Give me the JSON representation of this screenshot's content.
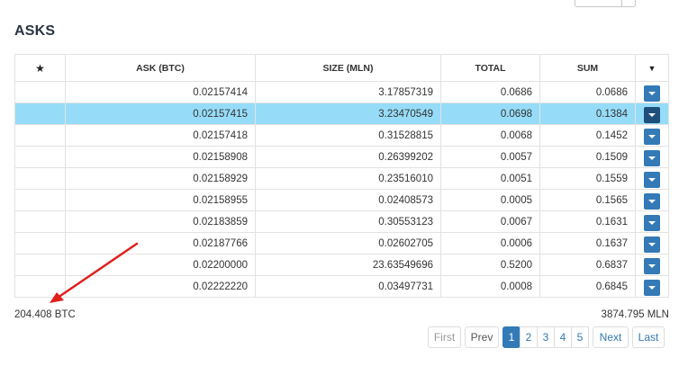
{
  "section_title": "ASKS",
  "table": {
    "headers": [
      "ASK (BTC)",
      "SIZE (MLN)",
      "TOTAL",
      "SUM"
    ],
    "rows": [
      {
        "ask": "0.02157414",
        "size": "3.17857319",
        "total": "0.0686",
        "sum": "0.0686"
      },
      {
        "ask": "0.02157415",
        "size": "3.23470549",
        "total": "0.0698",
        "sum": "0.1384"
      },
      {
        "ask": "0.02157418",
        "size": "0.31528815",
        "total": "0.0068",
        "sum": "0.1452"
      },
      {
        "ask": "0.02158908",
        "size": "0.26399202",
        "total": "0.0057",
        "sum": "0.1509"
      },
      {
        "ask": "0.02158929",
        "size": "0.23516010",
        "total": "0.0051",
        "sum": "0.1559"
      },
      {
        "ask": "0.02158955",
        "size": "0.02408573",
        "total": "0.0005",
        "sum": "0.1565"
      },
      {
        "ask": "0.02183859",
        "size": "0.30553123",
        "total": "0.0067",
        "sum": "0.1631"
      },
      {
        "ask": "0.02187766",
        "size": "0.02602705",
        "total": "0.0006",
        "sum": "0.1637"
      },
      {
        "ask": "0.02200000",
        "size": "23.63549696",
        "total": "0.5200",
        "sum": "0.6837"
      },
      {
        "ask": "0.02222220",
        "size": "0.03497731",
        "total": "0.0008",
        "sum": "0.6845"
      }
    ],
    "selected_row_index": 1
  },
  "footer": {
    "total_btc": "204.408 BTC",
    "total_mln": "3874.795 MLN"
  },
  "pagination": {
    "first": "First",
    "prev": "Prev",
    "pages": [
      "1",
      "2",
      "3",
      "4",
      "5"
    ],
    "active_page": "1",
    "next": "Next",
    "last": "Last"
  },
  "icons": {
    "favorite_header": "star-icon",
    "actions_header": "caret-down-icon",
    "row_action": "dropdown-button",
    "annotation": "red-arrow"
  },
  "colors": {
    "selected_row": "#96dcf8",
    "button_blue": "#337ab7",
    "annotation_arrow": "#e0201c"
  }
}
